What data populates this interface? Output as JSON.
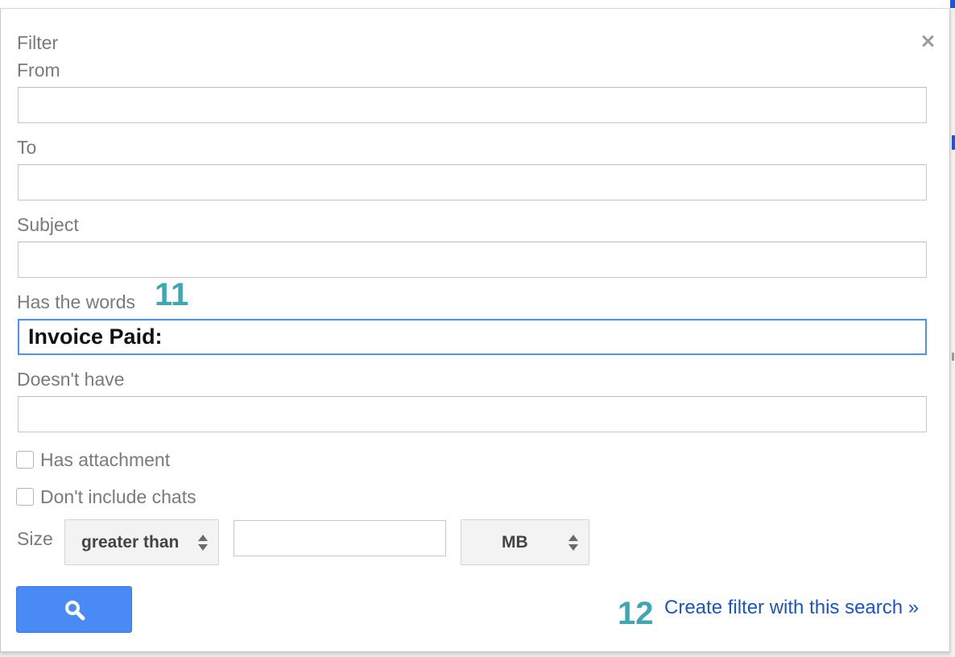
{
  "dialog": {
    "title": "Filter",
    "close_icon": "close-icon"
  },
  "fields": {
    "from_label": "From",
    "from_value": "",
    "to_label": "To",
    "to_value": "",
    "subject_label": "Subject",
    "subject_value": "",
    "has_words_label": "Has the words",
    "has_words_value": "Invoice Paid:",
    "doesnt_have_label": "Doesn't have",
    "doesnt_have_value": ""
  },
  "annotations": {
    "step_11": "11",
    "step_12": "12"
  },
  "checkboxes": {
    "has_attachment_label": "Has attachment",
    "has_attachment_checked": false,
    "dont_include_chats_label": "Don't include chats",
    "dont_include_chats_checked": false
  },
  "size": {
    "label": "Size",
    "operator_value": "greater than",
    "amount_value": "",
    "unit_value": "MB"
  },
  "actions": {
    "search_icon": "search-icon",
    "create_filter_link": "Create filter with this search »"
  },
  "colors": {
    "accent_blue": "#4a8af4",
    "link_blue": "#1a55c8",
    "annotation_teal": "#3ea7b2",
    "focus_border": "#4d90fe"
  }
}
